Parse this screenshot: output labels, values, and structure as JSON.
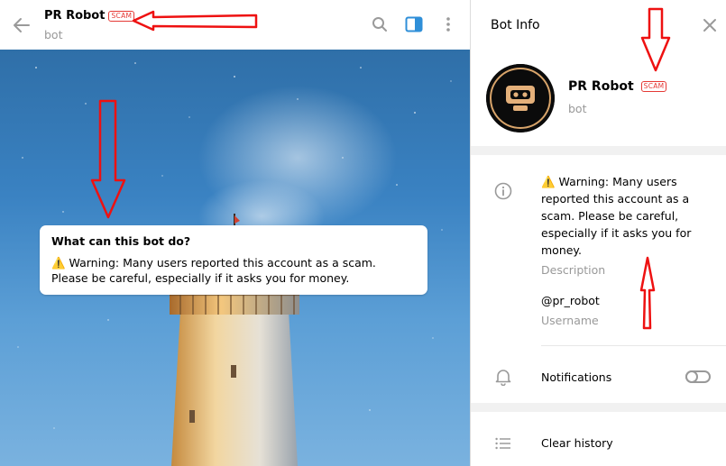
{
  "chat": {
    "title": "PR Robot",
    "badge": "SCAM",
    "subtitle": "bot",
    "card": {
      "title": "What can this bot do?",
      "text": "⚠️ Warning: Many users reported this account as a scam. Please be careful, especially if it asks you for money."
    }
  },
  "info": {
    "title": "Bot Info",
    "name": "PR Robot",
    "badge": "SCAM",
    "subtitle": "bot",
    "avatar_text": "PR Robot",
    "description": "⚠️ Warning: Many users reported this account as a scam. Please be careful, especially if it asks you for money.",
    "description_label": "Description",
    "username": "@pr_robot",
    "username_label": "Username",
    "notifications_label": "Notifications",
    "notifications_on": false,
    "clear_history_label": "Clear history"
  },
  "icons": {
    "back": "arrow-left-icon",
    "search": "search-icon",
    "sidebar": "sidebar-toggle-icon",
    "more": "more-vertical-icon",
    "close": "close-icon",
    "info": "info-icon",
    "bell": "bell-icon",
    "list": "list-icon"
  },
  "colors": {
    "accent": "#2f8fd8",
    "scam_red": "#e53935",
    "annotation_red": "#ee1111",
    "muted": "#999999"
  }
}
